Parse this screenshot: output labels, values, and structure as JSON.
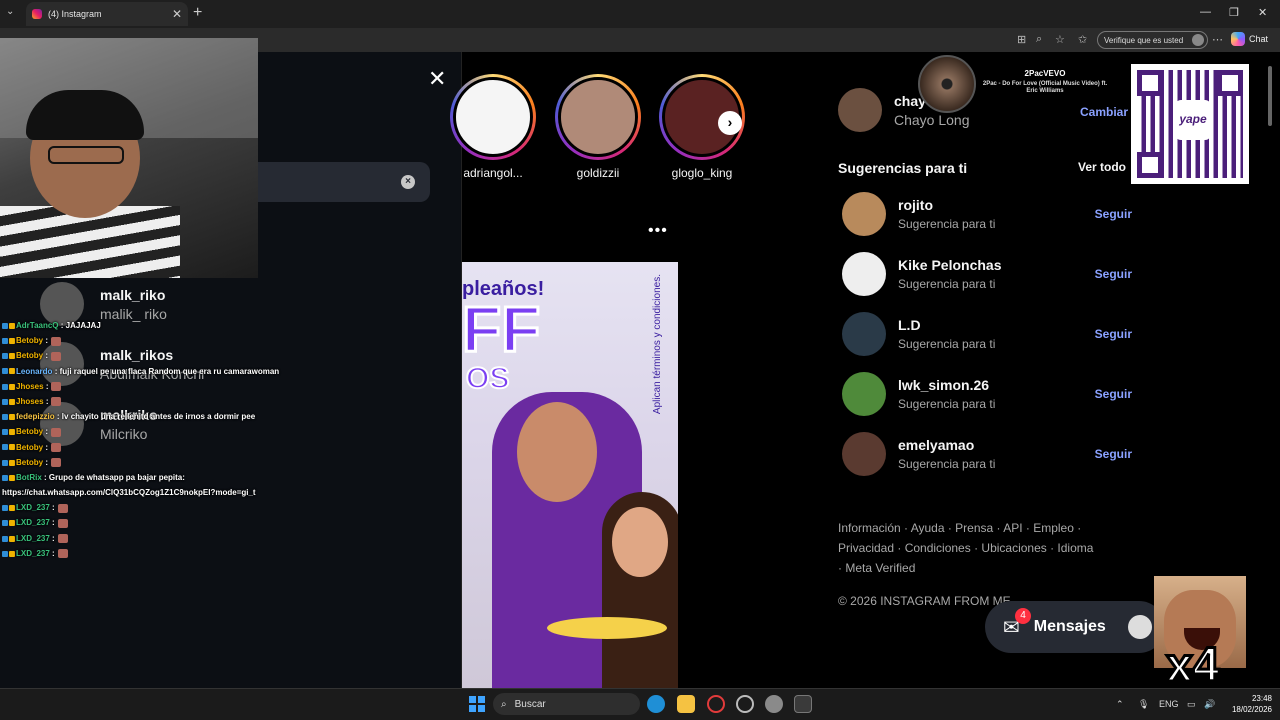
{
  "browser": {
    "tab_title": "(4) Instagram",
    "tab_close": "✕",
    "new_tab": "+",
    "verify_label": "Verifique que es usted",
    "chat_label": "Chat"
  },
  "search_panel": {
    "recent": [
      {
        "username": "malk_riko",
        "name": "malik_ riko"
      },
      {
        "username": "malk_rikos",
        "name": "Abdlmalk Korichi"
      },
      {
        "username": "malkriko",
        "name": "Milcriko"
      }
    ]
  },
  "stories": [
    {
      "label": "adriangol..."
    },
    {
      "label": "goldizzii"
    },
    {
      "label": "gloglo_king"
    }
  ],
  "post": {
    "text_a": "pleaños!",
    "text_b": "FF",
    "text_c": "OS",
    "side_text": "Aplican términos y condiciones."
  },
  "profile": {
    "username": "chayo",
    "name": "Chayo Long",
    "switch_label": "Cambiar"
  },
  "suggestions": {
    "title": "Sugerencias para ti",
    "see_all": "Ver todo",
    "follow_label": "Seguir",
    "items": [
      {
        "username": "rojito",
        "subtitle": "Sugerencia para ti"
      },
      {
        "username": "Kike Pelonchas",
        "subtitle": "Sugerencia para ti"
      },
      {
        "username": "L.D",
        "subtitle": "Sugerencia para ti"
      },
      {
        "username": "lwk_simon.26",
        "subtitle": "Sugerencia para ti"
      },
      {
        "username": "emelyamao",
        "subtitle": "Sugerencia para ti"
      }
    ]
  },
  "footer": {
    "links": "Información · Ayuda · Prensa · API · Empleo · Privacidad · Condiciones · Ubicaciones · Idioma · Meta Verified",
    "copyright": "© 2026 INSTAGRAM FROM ME"
  },
  "messages": {
    "label": "Mensajes",
    "badge": "4"
  },
  "stream_chat": [
    {
      "user": "AdrTaancQ",
      "text": ": JAJAJAJ",
      "color": "#39c17b"
    },
    {
      "user": "Betoby",
      "text": ":",
      "color": "#f0b400"
    },
    {
      "user": "Betoby",
      "text": ":",
      "color": "#f0b400"
    },
    {
      "user": "Leonardo",
      "text": ": fuji raquel pe una flaca Random que era ru camarawoman",
      "color": "#6ab7ff"
    },
    {
      "user": "Jhoses",
      "text": ":",
      "color": "#f0b400"
    },
    {
      "user": "Jhoses",
      "text": ":",
      "color": "#f0b400"
    },
    {
      "user": "fedepizzio",
      "text": ": lv chayito una rellenitd antes de irnos a dormir pee",
      "color": "#f5c242"
    },
    {
      "user": "Betoby",
      "text": ":",
      "color": "#f0b400"
    },
    {
      "user": "Betoby",
      "text": ":",
      "color": "#f0b400"
    },
    {
      "user": "Betoby",
      "text": ":",
      "color": "#f0b400"
    },
    {
      "user": "BotRix",
      "text": ": Grupo de whatsapp pa bajar pepita:",
      "color": "#39c17b"
    },
    {
      "user": "",
      "text": "https://chat.whatsapp.com/ClQ31bCQZog1Z1C9nokpEI?mode=gi_t",
      "color": "#ffffff"
    },
    {
      "user": "LXD_237",
      "text": ":",
      "color": "#39c17b"
    },
    {
      "user": "LXD_237",
      "text": ":",
      "color": "#39c17b"
    },
    {
      "user": "LXD_237",
      "text": ":",
      "color": "#39c17b"
    },
    {
      "user": "LXD_237",
      "text": ":",
      "color": "#39c17b"
    }
  ],
  "music": {
    "artist": "2PacVEVO",
    "title": "2Pac - Do For Love (Official Music Video) ft. Eric Williams"
  },
  "qr": {
    "logo": "yape"
  },
  "overlay_badge": "x4",
  "taskbar": {
    "search_placeholder": "Buscar",
    "lang": "ENG",
    "time": "23:48",
    "date": "18/02/2026"
  }
}
